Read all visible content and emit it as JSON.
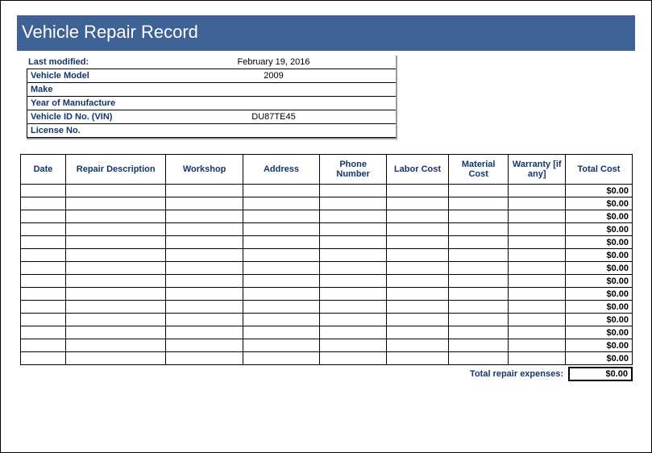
{
  "title": "Vehicle Repair Record",
  "info": {
    "last_modified_label": "Last modified:",
    "last_modified_value": "February 19, 2016",
    "model_label": "Vehicle Model",
    "model_value": "2009",
    "make_label": "Make",
    "make_value": "",
    "year_label": "Year of Manufacture",
    "year_value": "",
    "vin_label": "Vehicle ID No. (VIN)",
    "vin_value": "DU87TE45",
    "license_label": "License No.",
    "license_value": ""
  },
  "headers": {
    "date": "Date",
    "desc": "Repair Description",
    "workshop": "Workshop",
    "address": "Address",
    "phone": "Phone Number",
    "labor": "Labor Cost",
    "material": "Material Cost",
    "warranty": "Warranty [if any]",
    "total": "Total Cost"
  },
  "rows": [
    {
      "date": "",
      "desc": "",
      "workshop": "",
      "address": "",
      "phone": "",
      "labor": "",
      "material": "",
      "warranty": "",
      "total": "$0.00"
    },
    {
      "date": "",
      "desc": "",
      "workshop": "",
      "address": "",
      "phone": "",
      "labor": "",
      "material": "",
      "warranty": "",
      "total": "$0.00"
    },
    {
      "date": "",
      "desc": "",
      "workshop": "",
      "address": "",
      "phone": "",
      "labor": "",
      "material": "",
      "warranty": "",
      "total": "$0.00"
    },
    {
      "date": "",
      "desc": "",
      "workshop": "",
      "address": "",
      "phone": "",
      "labor": "",
      "material": "",
      "warranty": "",
      "total": "$0.00"
    },
    {
      "date": "",
      "desc": "",
      "workshop": "",
      "address": "",
      "phone": "",
      "labor": "",
      "material": "",
      "warranty": "",
      "total": "$0.00"
    },
    {
      "date": "",
      "desc": "",
      "workshop": "",
      "address": "",
      "phone": "",
      "labor": "",
      "material": "",
      "warranty": "",
      "total": "$0.00"
    },
    {
      "date": "",
      "desc": "",
      "workshop": "",
      "address": "",
      "phone": "",
      "labor": "",
      "material": "",
      "warranty": "",
      "total": "$0.00"
    },
    {
      "date": "",
      "desc": "",
      "workshop": "",
      "address": "",
      "phone": "",
      "labor": "",
      "material": "",
      "warranty": "",
      "total": "$0.00"
    },
    {
      "date": "",
      "desc": "",
      "workshop": "",
      "address": "",
      "phone": "",
      "labor": "",
      "material": "",
      "warranty": "",
      "total": "$0.00"
    },
    {
      "date": "",
      "desc": "",
      "workshop": "",
      "address": "",
      "phone": "",
      "labor": "",
      "material": "",
      "warranty": "",
      "total": "$0.00"
    },
    {
      "date": "",
      "desc": "",
      "workshop": "",
      "address": "",
      "phone": "",
      "labor": "",
      "material": "",
      "warranty": "",
      "total": "$0.00"
    },
    {
      "date": "",
      "desc": "",
      "workshop": "",
      "address": "",
      "phone": "",
      "labor": "",
      "material": "",
      "warranty": "",
      "total": "$0.00"
    },
    {
      "date": "",
      "desc": "",
      "workshop": "",
      "address": "",
      "phone": "",
      "labor": "",
      "material": "",
      "warranty": "",
      "total": "$0.00"
    },
    {
      "date": "",
      "desc": "",
      "workshop": "",
      "address": "",
      "phone": "",
      "labor": "",
      "material": "",
      "warranty": "",
      "total": "$0.00"
    }
  ],
  "summary": {
    "label": "Total repair expenses:",
    "value": "$0.00"
  }
}
